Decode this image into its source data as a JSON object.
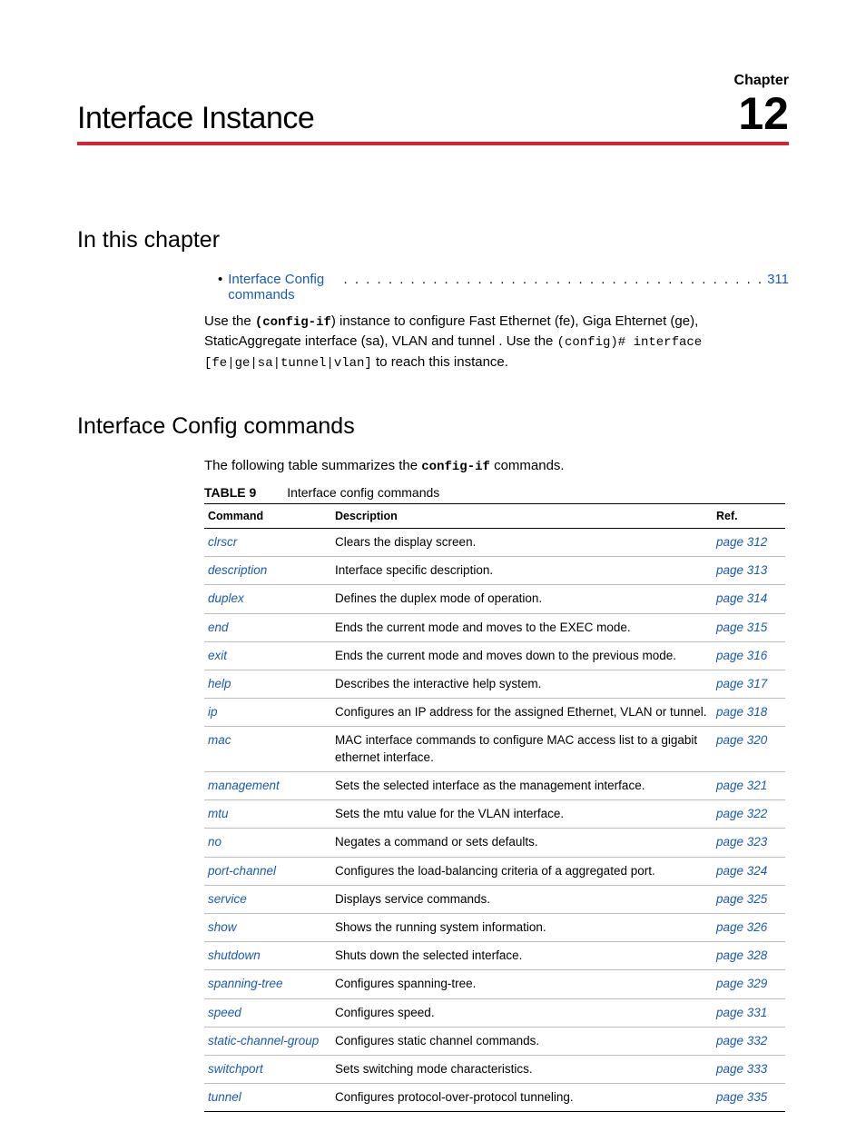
{
  "chapter": {
    "label": "Chapter",
    "title": "Interface Instance",
    "number": "12"
  },
  "sections": {
    "in_this_chapter": {
      "heading": "In this chapter",
      "toc": {
        "bullet": "•",
        "link_text": "Interface Config commands",
        "dots": ". . . . . . . . . . . . . . . . . . . . . . . . . . . . . . . . . . . . . .",
        "page": "311"
      },
      "body_parts": {
        "p1_a": "Use  the  ",
        "p1_b": "(config-if",
        "p1_c": ") instance to configure Fast Ethernet (fe), Giga Ehternet (ge), StaticAggregate interface (sa), VLAN and tunnel . Use the ",
        "p1_d": "(config)# interface [fe|ge|sa|tunnel|vlan]",
        "p1_e": " to reach this instance."
      }
    },
    "interface_config": {
      "heading": "Interface Config commands",
      "intro_a": "The following table summarizes the ",
      "intro_b": "config-if",
      "intro_c": " commands.",
      "table_label": "TABLE 9",
      "table_title": "Interface config commands",
      "columns": {
        "cmd": "Command",
        "desc": "Description",
        "ref": "Ref."
      },
      "rows": [
        {
          "cmd": "clrscr",
          "desc": "Clears the display screen.",
          "ref": "page 312"
        },
        {
          "cmd": "description",
          "desc": "Interface specific description.",
          "ref": "page 313"
        },
        {
          "cmd": "duplex",
          "desc": "Defines the duplex mode of operation.",
          "ref": "page 314"
        },
        {
          "cmd": "end",
          "desc": "Ends the current mode and moves to the EXEC mode.",
          "ref": "page 315"
        },
        {
          "cmd": "exit",
          "desc": "Ends the current mode and moves down to the previous mode.",
          "ref": "page 316"
        },
        {
          "cmd": "help",
          "desc": "Describes the interactive help system.",
          "ref": "page 317"
        },
        {
          "cmd": "ip",
          "desc": "Configures an IP address for the assigned Ethernet, VLAN or tunnel.",
          "ref": "page 318"
        },
        {
          "cmd": "mac",
          "desc": "MAC interface commands to configure MAC access list to a gigabit ethernet interface.",
          "ref": "page 320"
        },
        {
          "cmd": "management",
          "desc": "Sets the selected interface as the management interface.",
          "ref": "page 321"
        },
        {
          "cmd": "mtu",
          "desc": "Sets the mtu value for the VLAN interface.",
          "ref": "page 322"
        },
        {
          "cmd": "no",
          "desc": "Negates a command or sets defaults.",
          "ref": "page 323"
        },
        {
          "cmd": "port-channel",
          "desc": "Configures the load-balancing criteria of a aggregated port.",
          "ref": "page 324"
        },
        {
          "cmd": "service",
          "desc": "Displays service commands.",
          "ref": "page 325"
        },
        {
          "cmd": "show",
          "desc": "Shows the running system information.",
          "ref": "page 326"
        },
        {
          "cmd": "shutdown",
          "desc": "Shuts down the selected interface.",
          "ref": "page 328"
        },
        {
          "cmd": "spanning-tree",
          "desc": "Configures spanning-tree.",
          "ref": "page 329"
        },
        {
          "cmd": "speed",
          "desc": "Configures speed.",
          "ref": "page 331"
        },
        {
          "cmd": "static-channel-group",
          "desc": "Configures static channel commands.",
          "ref": "page 332"
        },
        {
          "cmd": "switchport",
          "desc": "Sets switching mode characteristics.",
          "ref": "page 333"
        },
        {
          "cmd": "tunnel",
          "desc": "Configures protocol-over-protocol tunneling.",
          "ref": "page 335"
        }
      ]
    }
  }
}
